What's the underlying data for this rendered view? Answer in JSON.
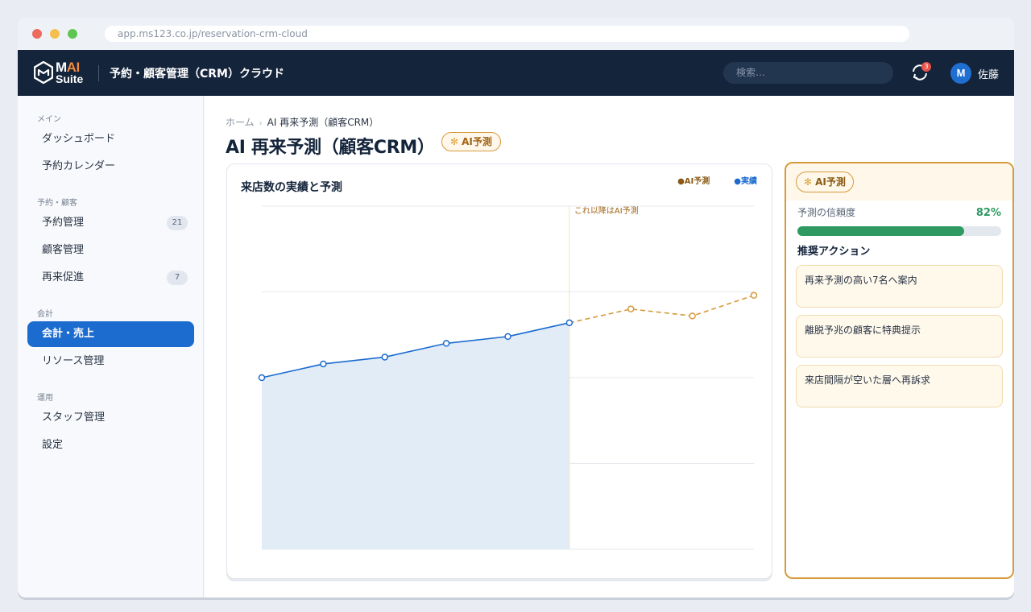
{
  "browser": {
    "url": "app.ms123.co.jp/reservation-crm-cloud"
  },
  "brand": {
    "logo_main": "M",
    "logo_ai": "AI",
    "logo_sub": "Suite"
  },
  "header": {
    "app_title": "予約・顧客管理（CRM）クラウド",
    "search_placeholder": "検索…",
    "sync_badge": "3",
    "avatar_initial": "M",
    "user_name": "佐藤"
  },
  "sidebar": {
    "sections": [
      {
        "label": "メイン",
        "items": [
          {
            "label": "ダッシュボード"
          },
          {
            "label": "予約カレンダー"
          }
        ]
      },
      {
        "label": "予約・顧客",
        "items": [
          {
            "label": "予約管理",
            "badge": "21"
          },
          {
            "label": "顧客管理"
          },
          {
            "label": "再来促進",
            "badge": "7"
          }
        ]
      },
      {
        "label": "会計",
        "items": [
          {
            "label": "会計・売上",
            "active": true
          },
          {
            "label": "リソース管理"
          }
        ]
      },
      {
        "label": "運用",
        "items": [
          {
            "label": "スタッフ管理"
          },
          {
            "label": "設定"
          }
        ]
      }
    ]
  },
  "breadcrumb": {
    "home": "ホーム",
    "separator": "›",
    "current": "AI 再来予測（顧客CRM）"
  },
  "page": {
    "title": "AI 再来予測（顧客CRM）",
    "ai_chip": "AI予測"
  },
  "chart_data": {
    "type": "line",
    "title": "来店数の実績と予測",
    "legend": [
      {
        "name": "AI予測",
        "color": "#8a5a14"
      },
      {
        "name": "実績",
        "color": "#1c6bcf"
      }
    ],
    "legend_position": "top-right",
    "annotation": "これ以降はAI予測",
    "grid": true,
    "ylim": [
      0,
      200
    ],
    "series": [
      {
        "name": "実績",
        "x": [
          0,
          1,
          2,
          3,
          4,
          5
        ],
        "values": [
          100,
          108,
          112,
          120,
          124,
          132
        ],
        "style": "solid-area",
        "color": "#1c6bcf"
      },
      {
        "name": "AI予測",
        "x": [
          5,
          6,
          7,
          8
        ],
        "values": [
          132,
          140,
          136,
          148
        ],
        "style": "dashed",
        "color": "#d69a3a"
      }
    ]
  },
  "ai_panel": {
    "chip": "AI予測",
    "confidence_label": "予測の信頼度",
    "confidence_value": "82%",
    "confidence_fraction": 0.82,
    "recommend_title": "推奨アクション",
    "actions": [
      "再来予測の高い7名へ案内",
      "離脱予兆の顧客に特典提示",
      "来店間隔が空いた層へ再訴求"
    ]
  },
  "colors": {
    "accent": "#1c6bcf",
    "ai": "#d69a3a",
    "success": "#2e9a62",
    "nav_bg": "#14243b"
  }
}
